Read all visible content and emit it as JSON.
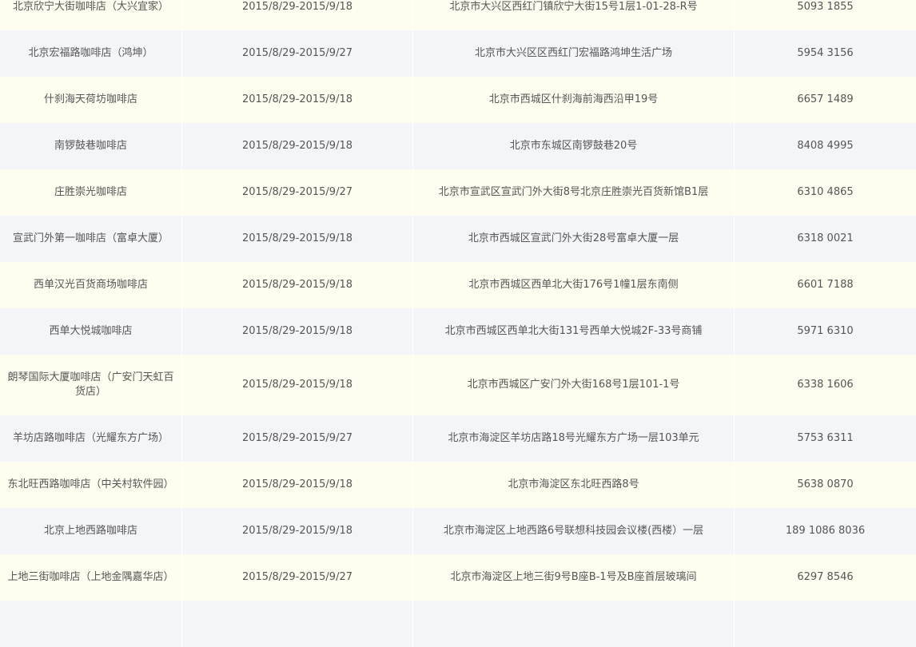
{
  "stores": [
    {
      "name": "北京欣宁大街咖啡店（大兴宜家）",
      "period": "2015/8/29-2015/9/18",
      "address": "北京市大兴区西红门镇欣宁大街15号1层1-01-28-R号",
      "phone": "5093 1855"
    },
    {
      "name": "北京宏福路咖啡店（鸿坤）",
      "period": "2015/8/29-2015/9/27",
      "address": "北京市大兴区区西红门宏福路鸿坤生活广场",
      "phone": "5954 3156"
    },
    {
      "name": "什刹海天荷坊咖啡店",
      "period": "2015/8/29-2015/9/18",
      "address": "北京市西城区什刹海前海西沿甲19号",
      "phone": "6657 1489"
    },
    {
      "name": "南锣鼓巷咖啡店",
      "period": "2015/8/29-2015/9/18",
      "address": "北京市东城区南锣鼓巷20号",
      "phone": "8408 4995"
    },
    {
      "name": "庄胜崇光咖啡店",
      "period": "2015/8/29-2015/9/27",
      "address": "北京市宣武区宣武门外大街8号北京庄胜崇光百货新馆B1层",
      "phone": "6310 4865"
    },
    {
      "name": "宣武门外第一咖啡店（富卓大厦）",
      "period": "2015/8/29-2015/9/18",
      "address": "北京市西城区宣武门外大街28号富卓大厦一层",
      "phone": "6318 0021"
    },
    {
      "name": "西单汉光百货商场咖啡店",
      "period": "2015/8/29-2015/9/18",
      "address": "北京市西城区西单北大街176号1幢1层东南侧",
      "phone": "6601 7188"
    },
    {
      "name": "西单大悦城咖啡店",
      "period": "2015/8/29-2015/9/18",
      "address": "北京市西城区西单北大街131号西单大悦城2F-33号商铺",
      "phone": "5971 6310"
    },
    {
      "name": "朗琴国际大厦咖啡店（广安门天虹百货店）",
      "period": "2015/8/29-2015/9/18",
      "address": "北京市西城区广安门外大街168号1层101-1号",
      "phone": "6338 1606"
    },
    {
      "name": "羊坊店路咖啡店（光耀东方广场）",
      "period": "2015/8/29-2015/9/27",
      "address": "北京市海淀区羊坊店路18号光耀东方广场一层103单元",
      "phone": "5753 6311"
    },
    {
      "name": "东北旺西路咖啡店（中关村软件园）",
      "period": "2015/8/29-2015/9/18",
      "address": "北京市海淀区东北旺西路8号",
      "phone": "5638 0870"
    },
    {
      "name": "北京上地西路咖啡店",
      "period": "2015/8/29-2015/9/18",
      "address": "北京市海淀区上地西路6号联想科技园会议楼(西楼）一层",
      "phone": "189 1086 8036"
    },
    {
      "name": "上地三街咖啡店（上地金隅嘉华店）",
      "period": "2015/8/29-2015/9/27",
      "address": "北京市海淀区上地三街9号B座B-1号及B座首层玻璃间",
      "phone": "6297 8546"
    },
    {
      "name": "",
      "period": "",
      "address": "",
      "phone": ""
    }
  ]
}
